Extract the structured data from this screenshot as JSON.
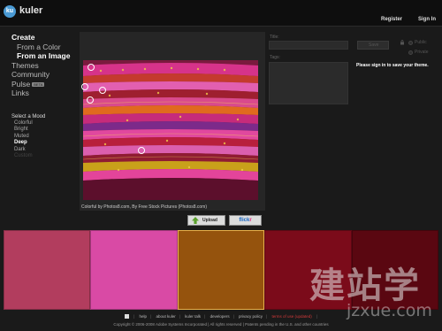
{
  "header": {
    "logo_mark": "ku",
    "app_name": "kuler",
    "register_label": "Register",
    "signin_label": "Sign In"
  },
  "nav": {
    "create": "Create",
    "from_color": "From a Color",
    "from_image": "From an Image",
    "themes": "Themes",
    "community": "Community",
    "pulse": "Pulse",
    "beta_badge": "BETA",
    "links": "Links",
    "mood_title": "Select a Mood",
    "moods": [
      "Colorful",
      "Bright",
      "Muted",
      "Deep",
      "Dark",
      "Custom"
    ],
    "active_mood": "Deep"
  },
  "image": {
    "caption": "Colorful by Photos8.com, By Free Stock Pictures (Photos8.com)",
    "photo_credit": "photos8.com"
  },
  "buttons": {
    "upload_label": "Upload",
    "flickr_part1": "flick",
    "flickr_part2": "r"
  },
  "form": {
    "title_label": "Title:",
    "title_value": "",
    "tags_label": "Tags:",
    "save_label": "Save",
    "public_label": "Public",
    "private_label": "Private",
    "signin_message": "Please sign in to save your theme."
  },
  "theme": {
    "swatches": [
      "#b23d5e",
      "#d94aa5",
      "#95530d",
      "#7b0b1a",
      "#5a0711"
    ],
    "selected_index": 2
  },
  "footer": {
    "links": [
      "help",
      "about kuler",
      "kuler talk",
      "developers",
      "privacy policy"
    ],
    "terms": "terms of use (updated)",
    "trailing": "|",
    "copyright": "Copyright © 2006-2008 Adobe Systems Incorporated | All rights reserved | Patents pending in the U.S. and other countries"
  },
  "watermark": {
    "chinese": "建站学",
    "url": "jzxue.com"
  },
  "colors": {
    "accent": "#4a9ad4",
    "swatch_selected_border": "#e8b04a",
    "terms_link": "#d23a3a"
  },
  "icons": [
    "kuler-logo-icon",
    "upload-arrow-icon",
    "lock-icon",
    "adobe-icon"
  ]
}
